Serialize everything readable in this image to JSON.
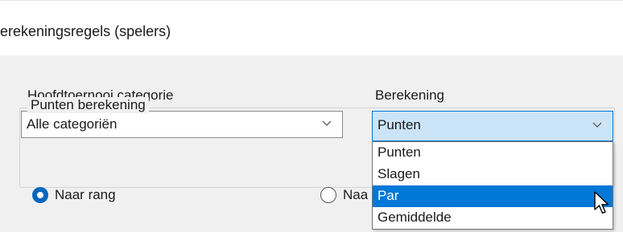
{
  "window": {
    "title": "erekeningsregels (spelers)"
  },
  "form": {
    "category_label": "Hoofdtoernooi categorie",
    "category_value": "Alle categoriën",
    "calc_label": "Berekening",
    "calc_value": "Punten"
  },
  "points_group": {
    "legend": "Punten berekening",
    "option_rank": "Naar rang",
    "option_other_visible": "Naa"
  },
  "dropdown": {
    "items": [
      {
        "label": "Punten"
      },
      {
        "label": "Slagen"
      },
      {
        "label": "Par"
      },
      {
        "label": "Gemiddelde"
      }
    ],
    "selected_label": "Par"
  },
  "colors": {
    "accent": "#0078d7",
    "combo_active_bg": "#cce4f7",
    "client_bg": "#f0f0f0"
  },
  "icons": [
    "chevron-down-icon",
    "mouse-pointer-icon"
  ]
}
